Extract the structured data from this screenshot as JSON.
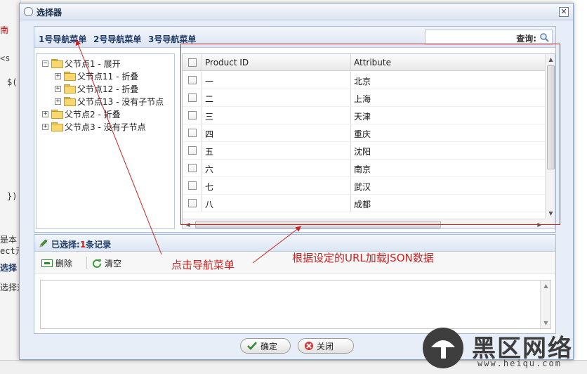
{
  "background": {
    "fragments": [
      "南",
      "<s",
      "$(",
      "})",
      "是本",
      "ect元",
      "选择",
      "选择对"
    ]
  },
  "dialog": {
    "title": "选择器",
    "close_glyph": "✕",
    "nav_menu": [
      "1号导航菜单",
      "2号导航菜单",
      "3号导航菜单"
    ],
    "query_label": "查询:",
    "tree": [
      {
        "toggle": "−",
        "label": "父节点1 - 展开",
        "level": 0
      },
      {
        "toggle": "+",
        "label": "父节点11 - 折叠",
        "level": 1
      },
      {
        "toggle": "+",
        "label": "父节点12 - 折叠",
        "level": 1
      },
      {
        "toggle": "+",
        "label": "父节点13 - 没有子节点",
        "level": 1
      },
      {
        "toggle": "+",
        "label": "父节点2 - 折叠",
        "level": 0
      },
      {
        "toggle": "+",
        "label": "父节点3 - 没有子节点",
        "level": 0
      }
    ],
    "grid": {
      "columns": [
        "Product ID",
        "Attribute"
      ],
      "rows": [
        {
          "id": "一",
          "attr": "北京"
        },
        {
          "id": "二",
          "attr": "上海"
        },
        {
          "id": "三",
          "attr": "天津"
        },
        {
          "id": "四",
          "attr": "重庆"
        },
        {
          "id": "五",
          "attr": "沈阳"
        },
        {
          "id": "六",
          "attr": "南京"
        },
        {
          "id": "七",
          "attr": "武汉"
        },
        {
          "id": "八",
          "attr": "成都"
        }
      ]
    },
    "selected": {
      "prefix": "已选择:",
      "count": "1",
      "suffix": "条记录"
    },
    "toolbar": {
      "delete_label": "删除",
      "clear_label": "清空"
    },
    "buttons": {
      "ok_label": "确定",
      "close_label": "关闭"
    }
  },
  "annotations": {
    "click_nav": "点击导航菜单",
    "load_json": "根据设定的URL加载JSON数据"
  },
  "watermark": {
    "text": "黑区网络",
    "url": "www.heiqu.com"
  },
  "colors": {
    "accent_red": "#cc2222",
    "title_blue": "#1f3a66"
  }
}
